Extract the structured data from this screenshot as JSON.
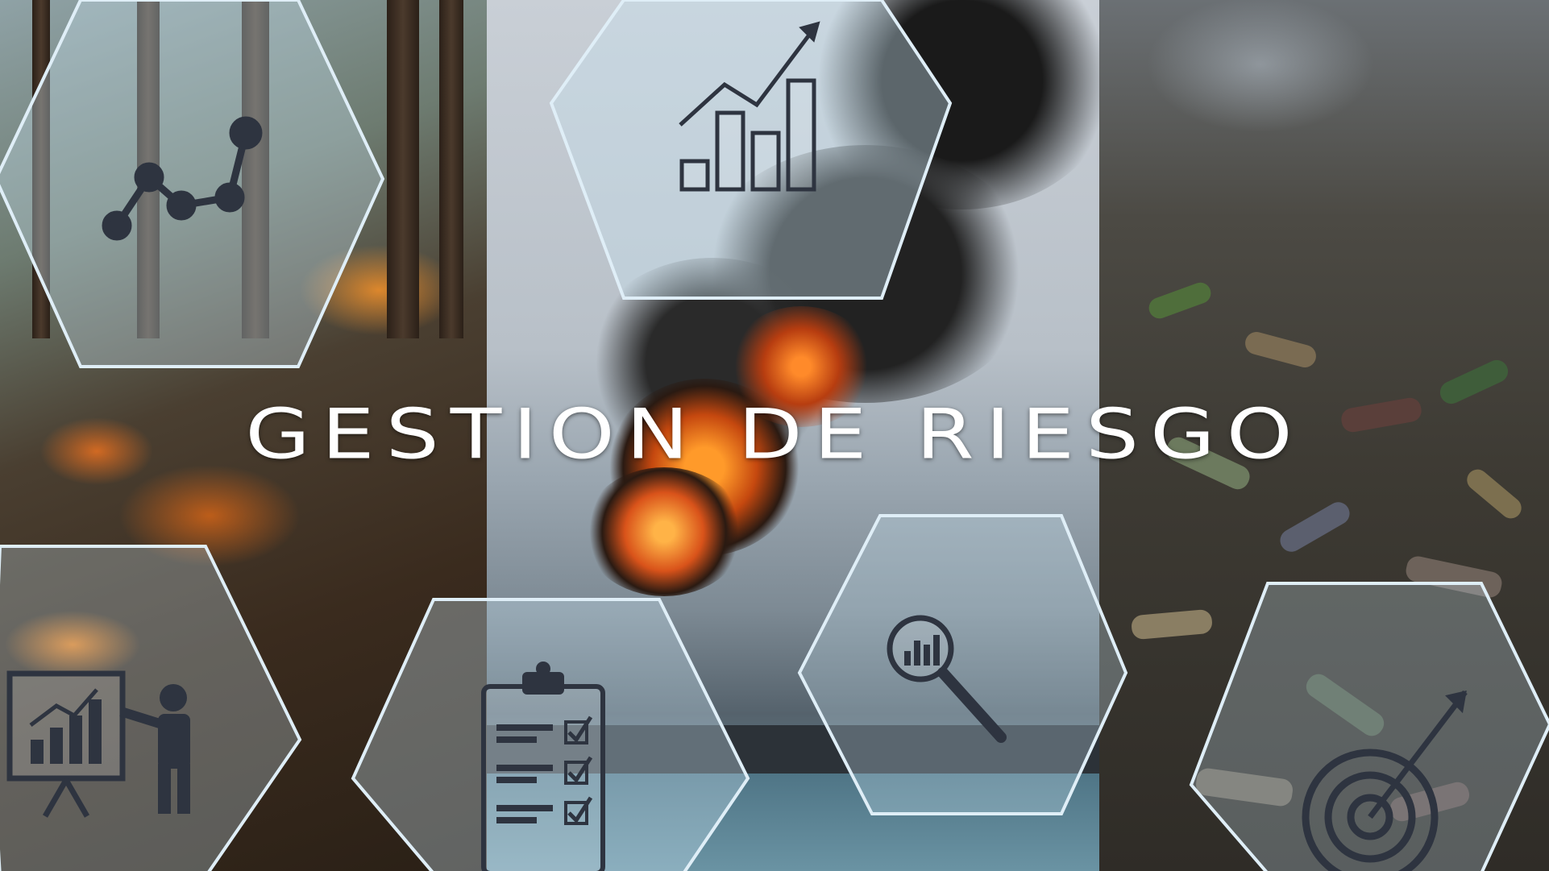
{
  "title": "GESTION DE RIESGO",
  "colors": {
    "title": "#ffffff",
    "hex_fill": "rgba(200,225,240,0.35)",
    "hex_stroke": "#dfeef7",
    "icon": "#2e3440"
  },
  "panels": [
    {
      "name": "forest-fire-photo"
    },
    {
      "name": "industrial-explosion-photo"
    },
    {
      "name": "polluted-shore-photo"
    }
  ],
  "hexagons": [
    {
      "icon": "line-graph-icon"
    },
    {
      "icon": "growth-bar-chart-icon"
    },
    {
      "icon": "presentation-icon"
    },
    {
      "icon": "checklist-icon"
    },
    {
      "icon": "magnifier-chart-icon"
    },
    {
      "icon": "target-icon"
    }
  ]
}
